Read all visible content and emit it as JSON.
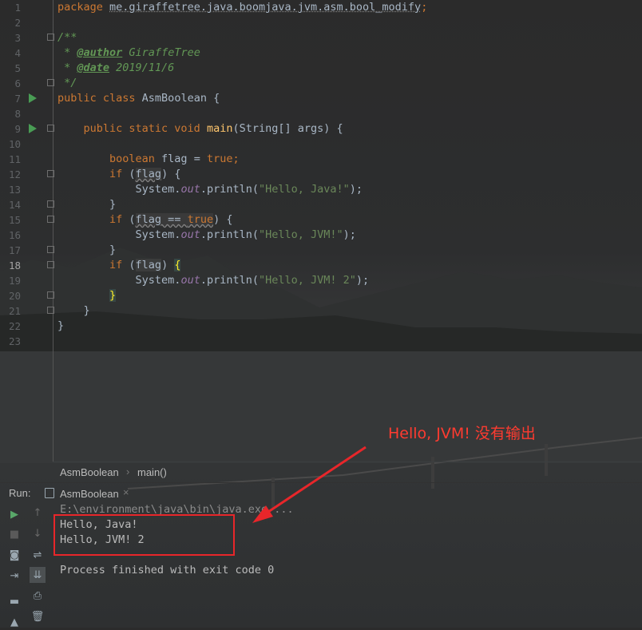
{
  "editor": {
    "lines": [
      {
        "n": "1"
      },
      {
        "n": "2"
      },
      {
        "n": "3"
      },
      {
        "n": "4"
      },
      {
        "n": "5"
      },
      {
        "n": "6"
      },
      {
        "n": "7"
      },
      {
        "n": "8"
      },
      {
        "n": "9"
      },
      {
        "n": "10"
      },
      {
        "n": "11"
      },
      {
        "n": "12"
      },
      {
        "n": "13"
      },
      {
        "n": "14"
      },
      {
        "n": "15"
      },
      {
        "n": "16"
      },
      {
        "n": "17"
      },
      {
        "n": "18"
      },
      {
        "n": "19"
      },
      {
        "n": "20"
      },
      {
        "n": "21"
      },
      {
        "n": "22"
      },
      {
        "n": "23"
      }
    ],
    "code": {
      "l1_kw": "package",
      "l1_pkg": "me.giraffetree.java.boomjava.jvm.asm.bool_modify",
      "l1_semi": ";",
      "l3": "/**",
      "l4_pre": " * ",
      "l4_tag": "@author",
      "l4_val": " GiraffeTree",
      "l5_pre": " * ",
      "l5_tag": "@date",
      "l5_val": " 2019/11/6",
      "l6": " */",
      "l7_kw": "public class",
      "l7_name": " AsmBoolean {",
      "l9_kw": "    public static void",
      "l9_fn": "main",
      "l9_rest": "(String[] args) {",
      "l11_kw": "        boolean",
      "l11_mid": " flag = ",
      "l11_val": "true",
      "l11_end": ";",
      "l12_kw": "        if",
      "l12_open": " (",
      "l12_var": "flag",
      "l12_close": ") {",
      "l13_pre": "            System.",
      "l13_field": "out",
      "l13_call": ".println(",
      "l13_str": "\"Hello, Java!\"",
      "l13_end": ");",
      "l14": "        }",
      "l15_kw": "        if",
      "l15_open": " (",
      "l15_var": "flag == ",
      "l15_val": "true",
      "l15_close": ") {",
      "l16_pre": "            System.",
      "l16_field": "out",
      "l16_call": ".println(",
      "l16_str": "\"Hello, JVM!\"",
      "l16_end": ");",
      "l17": "        }",
      "l18_kw": "        if",
      "l18_open": " (",
      "l18_var": "flag",
      "l18_close": ") ",
      "l18_brace": "{",
      "l19_pre": "            System.",
      "l19_field": "out",
      "l19_call": ".println(",
      "l19_str": "\"Hello, JVM! 2\"",
      "l19_end": ");",
      "l20_pre": "        ",
      "l20_brace": "}",
      "l21": "    }",
      "l22": "}"
    }
  },
  "breadcrumb": {
    "class_name": "AsmBoolean",
    "separator": "›",
    "method": "main()"
  },
  "run_panel": {
    "label": "Run:",
    "tab_name": "AsmBoolean",
    "tab_close": "×",
    "console": {
      "command": "E:\\environment\\java\\bin\\java.exe ...",
      "out1": "Hello, Java!",
      "out2": "Hello, JVM! 2",
      "finish": "Process finished with exit code 0"
    }
  },
  "annotation": {
    "text": "Hello, JVM! 没有输出",
    "color": "#ff3b30"
  },
  "colors": {
    "keyword": "#cc7832",
    "string": "#6a8759",
    "comment": "#629755",
    "method": "#ffc66d",
    "field": "#9876aa",
    "run_marker": "#499c54",
    "highlight_box": "#e8262a"
  },
  "icons": {
    "run": "run-icon",
    "stop": "stop-icon",
    "camera": "screenshot-icon",
    "login": "restore-layout-icon",
    "layout": "layout-icon",
    "pin": "pin-icon",
    "up": "up-arrow-icon",
    "down": "down-arrow-icon",
    "wrap": "soft-wrap-icon",
    "scroll": "scroll-to-end-icon",
    "print": "print-icon",
    "trash": "trash-icon"
  }
}
